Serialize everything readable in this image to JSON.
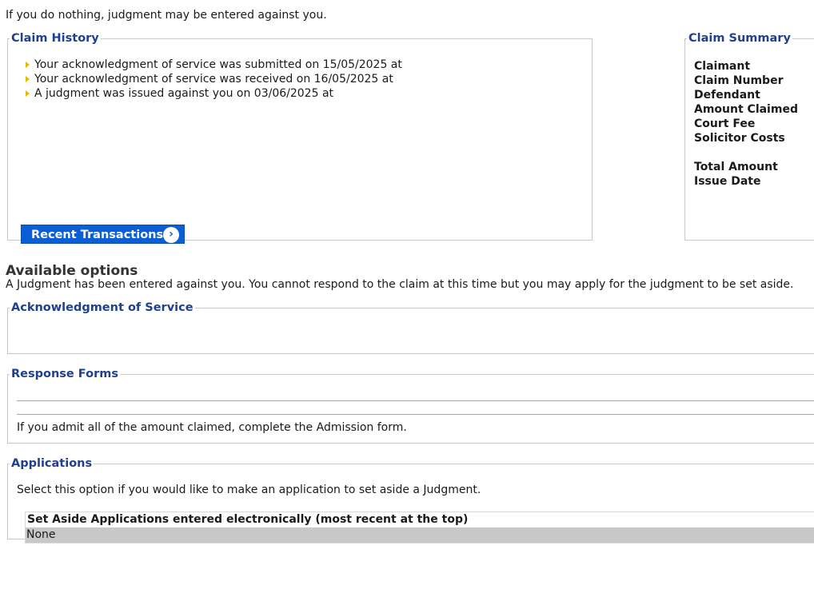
{
  "warning": "If you do nothing, judgment may be entered against you.",
  "claim_history": {
    "legend": "Claim History",
    "items": [
      "Your acknowledgment of service was submitted on 15/05/2025 at",
      "Your acknowledgment of service was received on 16/05/2025 at",
      "A judgment was issued against you on 03/06/2025 at"
    ],
    "button_label": "Recent Transactions"
  },
  "claim_summary": {
    "legend": "Claim Summary",
    "labels": [
      "Claimant",
      "Claim Number",
      "Defendant",
      "Amount Claimed",
      "Court Fee",
      "Solicitor Costs",
      "Total Amount",
      "Issue Date"
    ]
  },
  "options": {
    "title": "Available options",
    "description": "A Judgment has been entered against you. You cannot respond to the claim at this time but you may apply for the judgment to be set aside."
  },
  "acknowledgment": {
    "legend": "Acknowledgment of Service"
  },
  "response_forms": {
    "legend": "Response Forms",
    "text": "If you admit all of the amount claimed, complete the Admission form."
  },
  "applications": {
    "legend": "Applications",
    "text": "Select this option if you would like to make an application to set aside a Judgment.",
    "table_header": "Set Aside Applications entered electronically (most recent at the top)",
    "rows": [
      "None"
    ]
  },
  "colors": {
    "legend_blue": "#1f3f8f",
    "button_blue": "#0a5fd6",
    "bullet_yellow": "#e8b800"
  },
  "icons": {
    "bullet": "arrow-bullet-icon",
    "button": "chevron-right-circle-icon"
  }
}
